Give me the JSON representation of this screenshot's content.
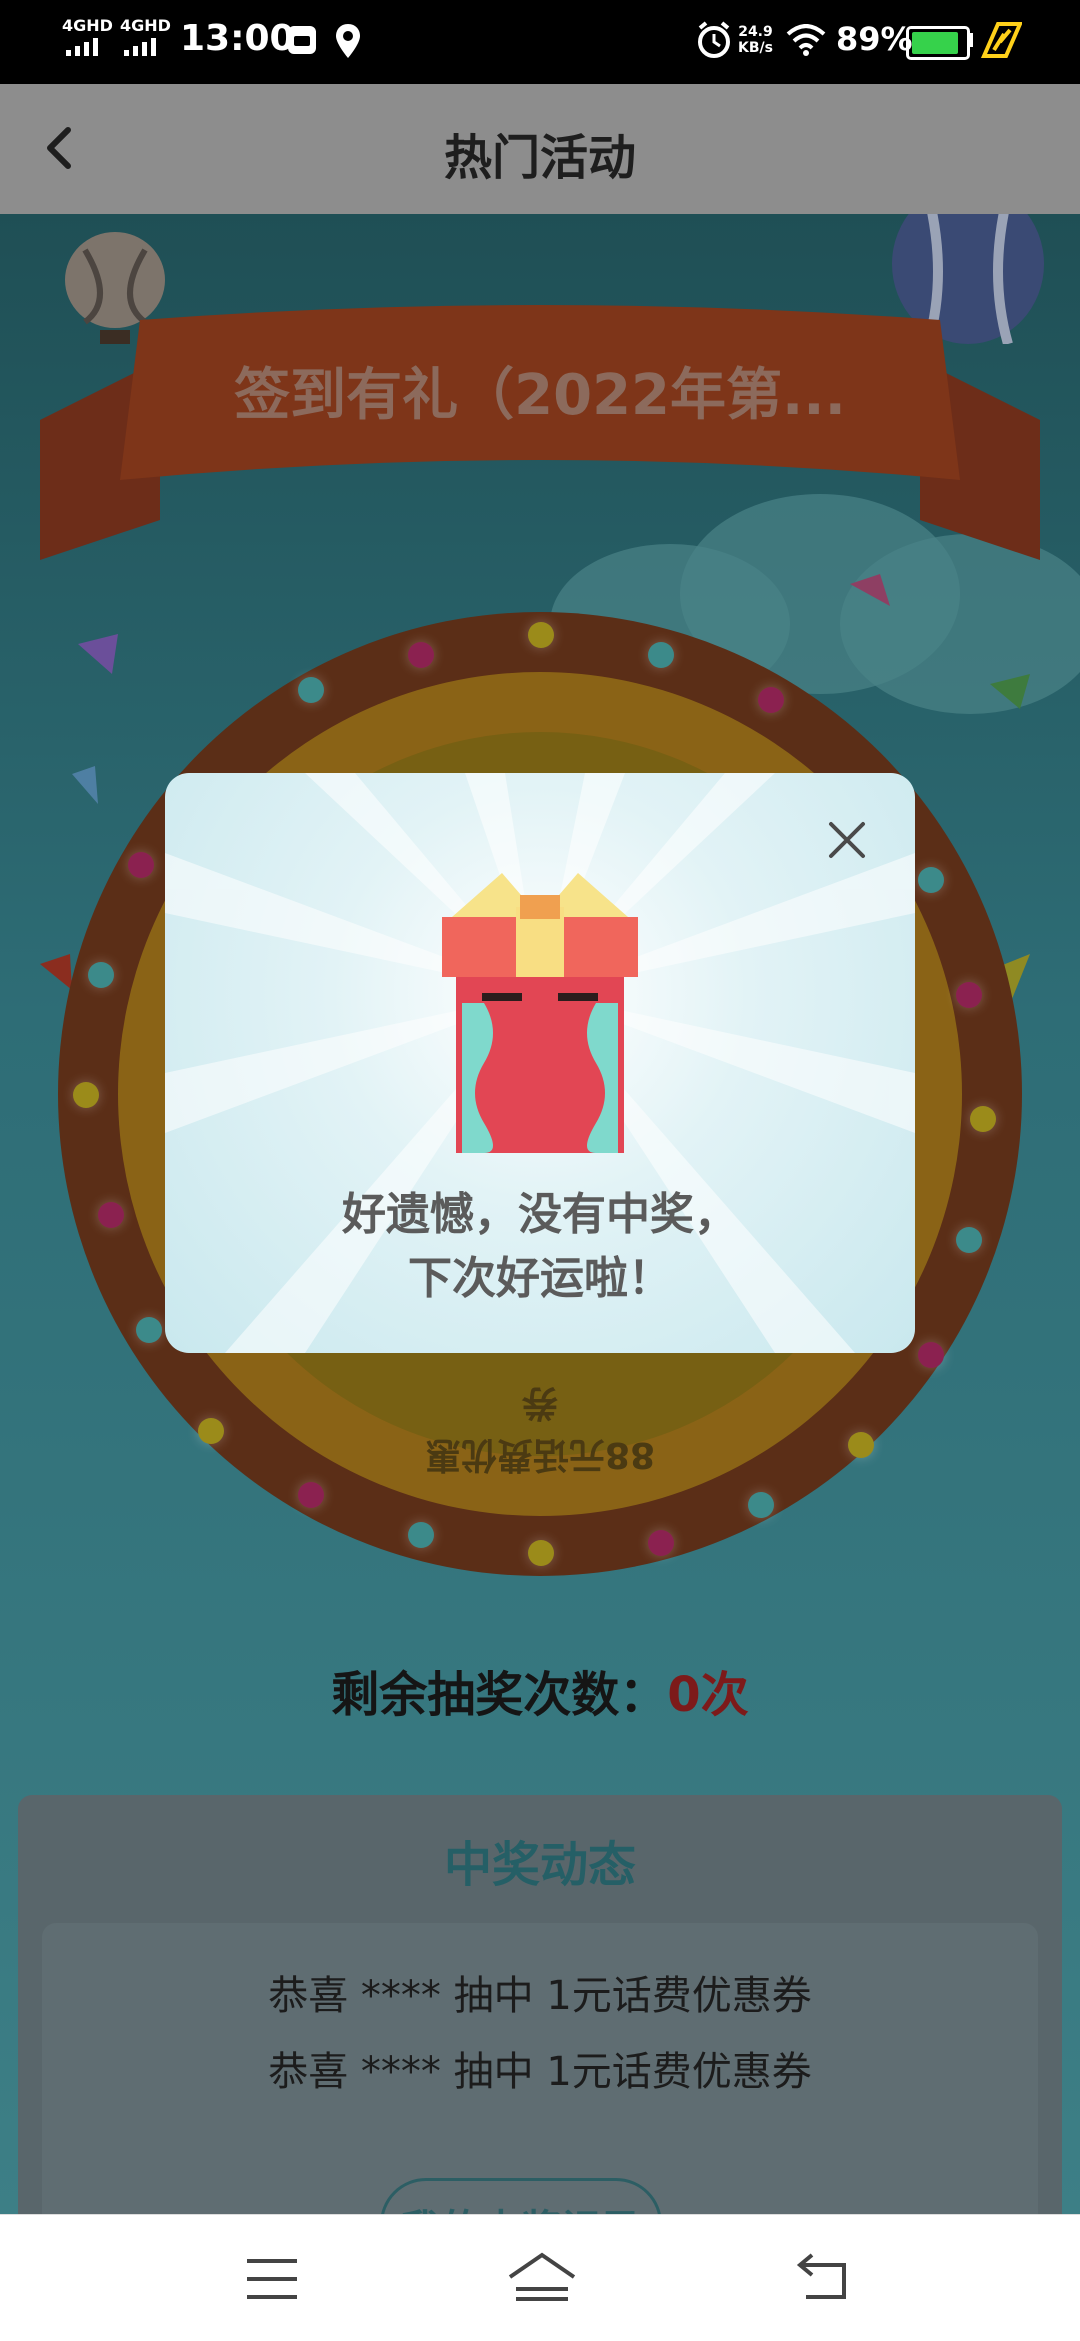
{
  "status_bar": {
    "net1": "4GHD",
    "net2": "4GHD",
    "time": "13:00",
    "speed_value": "24.9",
    "speed_unit": "KB/s",
    "battery": "89%"
  },
  "app_bar": {
    "title": "热门活动"
  },
  "activity": {
    "banner_title": "签到有礼（2022年第...",
    "wheel_prize_text": "88元话费优惠券",
    "remaining_label": "剩余抽奖次数：",
    "remaining_value": "0次"
  },
  "winners": {
    "title": "中奖动态",
    "rows": [
      "恭喜  ****  抽中  1元话费优惠券",
      "恭喜  ****  抽中  1元话费优惠券"
    ],
    "record_button": "我的中奖记录"
  },
  "modal": {
    "line1": "好遗憾，没有中奖，",
    "line2": "下次好运啦！"
  },
  "colors": {
    "modal_bg": "#d8eef2",
    "remaining_value": "#e52a2a",
    "winners_title": "#3a8a94"
  }
}
